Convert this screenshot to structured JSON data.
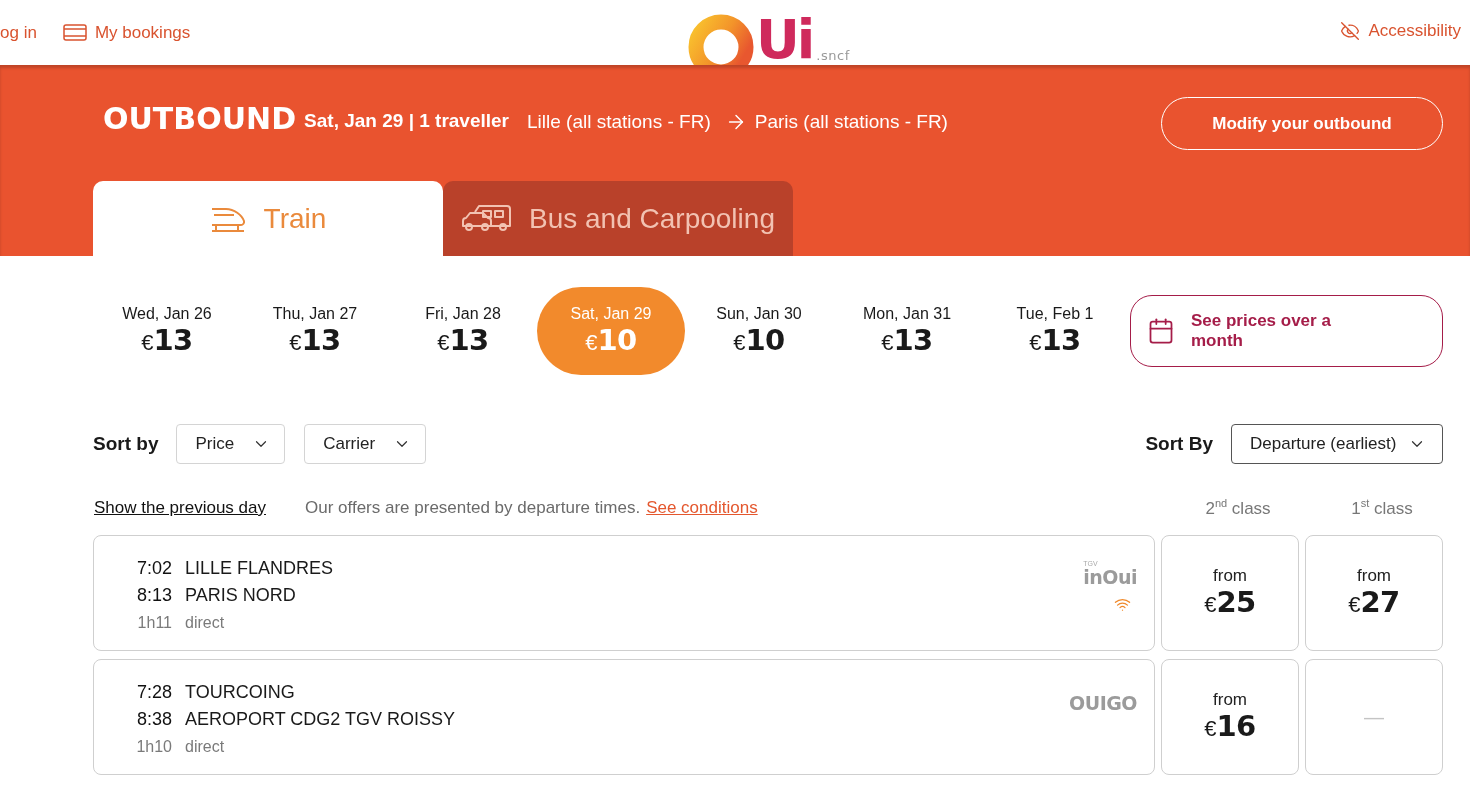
{
  "header": {
    "links": [
      {
        "kind": "login",
        "label": "og in"
      },
      {
        "kind": "bookings",
        "label": "My bookings"
      }
    ],
    "logo": {
      "mark": "Ui",
      "suffix": ".sncf"
    },
    "accessibility": "Accessibility"
  },
  "journey": {
    "direction": "OUTBOUND",
    "details": "Sat, Jan 29 | 1 traveller",
    "origin": "Lille (all stations - FR)",
    "destination": "Paris (all stations - FR)",
    "modify_button": "Modify your outbound"
  },
  "modes": [
    {
      "kind": "train",
      "label": "Train",
      "selected": true
    },
    {
      "kind": "bus",
      "label": "Bus and Carpooling",
      "selected": false
    }
  ],
  "dates": [
    {
      "label": "Wed, Jan 26",
      "currency": "€",
      "amount": "13",
      "selected": false
    },
    {
      "label": "Thu, Jan 27",
      "currency": "€",
      "amount": "13",
      "selected": false
    },
    {
      "label": "Fri, Jan 28",
      "currency": "€",
      "amount": "13",
      "selected": false
    },
    {
      "label": "Sat, Jan 29",
      "currency": "€",
      "amount": "10",
      "selected": true
    },
    {
      "label": "Sun, Jan 30",
      "currency": "€",
      "amount": "10",
      "selected": false
    },
    {
      "label": "Mon, Jan 31",
      "currency": "€",
      "amount": "13",
      "selected": false
    },
    {
      "label": "Tue, Feb 1",
      "currency": "€",
      "amount": "13",
      "selected": false
    }
  ],
  "month_button": "See prices over a month",
  "sort": {
    "label": "Sort by",
    "filters": [
      "Price",
      "Carrier"
    ],
    "order_label": "Sort By",
    "order": "Departure (earliest)"
  },
  "info": {
    "previous_day": "Show the previous day",
    "notice": "Our offers are presented by departure times.",
    "conditions": "See conditions",
    "classes": [
      "2$^{nd}$ class",
      "1$^{st}$ class"
    ]
  },
  "trips": [
    {
      "departure": "7:02",
      "origin": "LILLE FLANDRES",
      "arrival": "8:13",
      "destination": "PARIS NORD",
      "duration": "1h11",
      "stops": "direct",
      "carrier": {
        "tag": "TGV",
        "name": "inOui"
      },
      "wifi": true,
      "fares": [
        {
          "kind": "offer",
          "label": "from",
          "currency": "€",
          "amount": "25"
        },
        {
          "kind": "offer",
          "label": "from",
          "currency": "€",
          "amount": "27"
        }
      ]
    },
    {
      "departure": "7:28",
      "origin": "TOURCOING",
      "arrival": "8:38",
      "destination": "AEROPORT CDG2 TGV ROISSY",
      "duration": "1h10",
      "stops": "direct",
      "carrier": {
        "name": "OUIGO"
      },
      "wifi": false,
      "fares": [
        {
          "kind": "offer",
          "label": "from",
          "currency": "€",
          "amount": "16"
        },
        {
          "kind": "none",
          "text": "—"
        }
      ]
    }
  ]
}
